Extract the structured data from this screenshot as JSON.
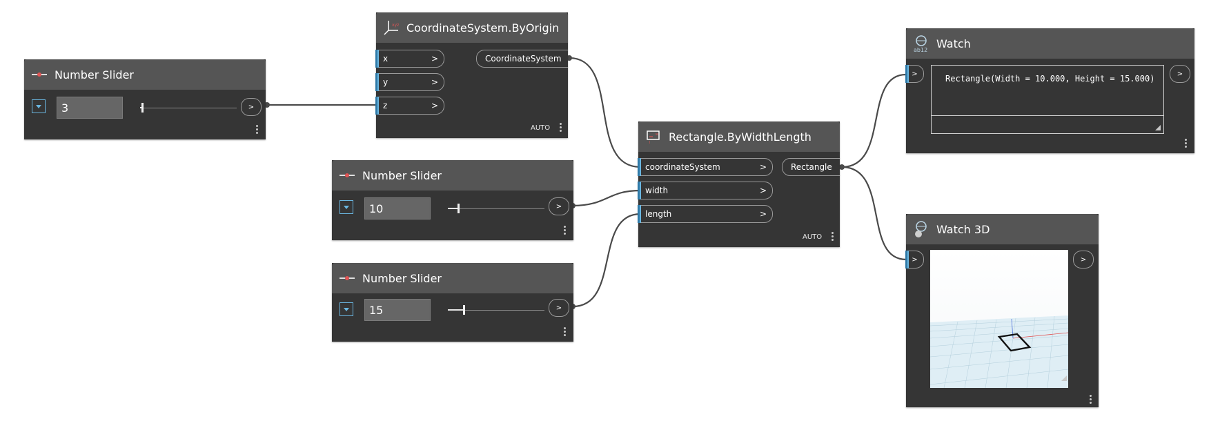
{
  "nodes": {
    "slider1": {
      "title": "Number Slider",
      "value": "3",
      "out": ">"
    },
    "coord": {
      "title": "CoordinateSystem.ByOrigin",
      "inputs": [
        "x",
        "y",
        "z"
      ],
      "input_chevron": ">",
      "output": "CoordinateSystem",
      "lacing": "AUTO"
    },
    "slider2": {
      "title": "Number Slider",
      "value": "10",
      "out": ">"
    },
    "slider3": {
      "title": "Number Slider",
      "value": "15",
      "out": ">"
    },
    "rect": {
      "title": "Rectangle.ByWidthLength",
      "inputs": [
        "coordinateSystem",
        "width",
        "length"
      ],
      "input_chevron": ">",
      "output": "Rectangle",
      "lacing": "AUTO"
    },
    "watch": {
      "title": "Watch",
      "in": ">",
      "out": ">",
      "result": "Rectangle(Width = 10.000, Height = 15.000)"
    },
    "watch3d": {
      "title": "Watch 3D",
      "in": ">",
      "out": ">"
    }
  },
  "sliders": {
    "slider1": {
      "fraction": 0.02
    },
    "slider2": {
      "fraction": 0.1
    },
    "slider3": {
      "fraction": 0.16
    }
  },
  "colors": {
    "node_body": "#353535",
    "node_header": "#555555",
    "port_accent": "#6ab6e0",
    "wire": "#4a4a4a",
    "grid_background": "#dfeef5"
  },
  "icons": {
    "slider": "slider-icon",
    "coordinate_system": "coordinate-system-icon",
    "rectangle": "rectangle-icon",
    "watch": "watch-icon",
    "watch3d": "watch3d-icon"
  }
}
